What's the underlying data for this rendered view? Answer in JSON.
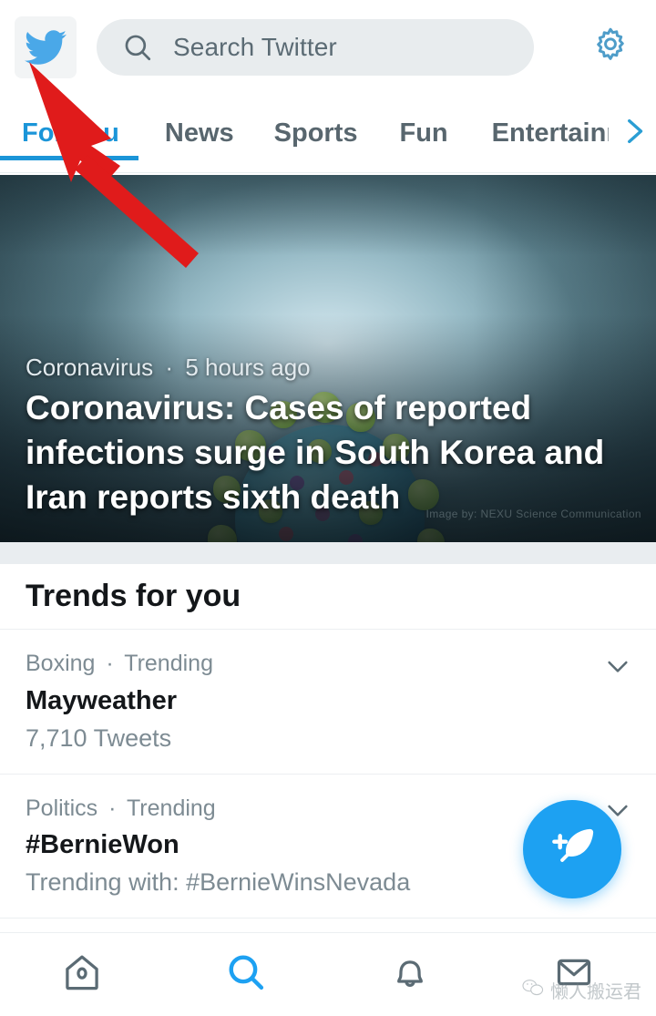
{
  "app": {
    "name": "Twitter",
    "accent_color": "#1DA1F2",
    "tab_active_color": "#1B95D8",
    "muted_text_color": "#7D8B93",
    "dark_text_color": "#14171A"
  },
  "topbar": {
    "logo_icon": "twitter-bird-icon",
    "search": {
      "icon": "search-icon",
      "placeholder": "Search Twitter",
      "value": ""
    },
    "settings_icon": "gear-icon"
  },
  "tabs": {
    "items": [
      {
        "label": "For You",
        "active": true
      },
      {
        "label": "News",
        "active": false
      },
      {
        "label": "Sports",
        "active": false
      },
      {
        "label": "Fun",
        "active": false
      },
      {
        "label": "Entertainment",
        "active": false
      }
    ],
    "next_icon": "chevron-right-icon"
  },
  "hero": {
    "category": "Coronavirus",
    "separator": "·",
    "timestamp": "5 hours ago",
    "headline": "Coronavirus: Cases of reported infections surge in South Korea and Iran reports sixth death",
    "image_credit": "Image by: NEXU Science Communication"
  },
  "trends": {
    "title": "Trends for you",
    "items": [
      {
        "category": "Boxing",
        "separator": "·",
        "status": "Trending",
        "name": "Mayweather",
        "sub": "7,710 Tweets",
        "caret_icon": "chevron-down-icon"
      },
      {
        "category": "Politics",
        "separator": "·",
        "status": "Trending",
        "name": "#BernieWon",
        "sub": "Trending with: #BernieWinsNevada",
        "caret_icon": "chevron-down-icon"
      }
    ]
  },
  "compose_fab": {
    "icon": "compose-feather-plus-icon",
    "label": "Tweet"
  },
  "bottom_nav": {
    "items": [
      {
        "icon": "home-icon",
        "label": "Home",
        "active": false
      },
      {
        "icon": "search-icon",
        "label": "Search",
        "active": true
      },
      {
        "icon": "bell-icon",
        "label": "Notifications",
        "active": false
      },
      {
        "icon": "envelope-icon",
        "label": "Messages",
        "active": false
      }
    ]
  },
  "watermark": {
    "icon": "wechat-icon",
    "text": "懒人搬运君"
  },
  "annotation": {
    "arrow": "red-arrow-pointing-to-twitter-logo",
    "color": "#E01B1B"
  }
}
